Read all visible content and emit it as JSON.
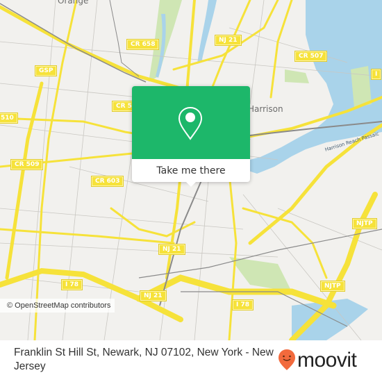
{
  "map": {
    "place_labels": {
      "orange": "Orange",
      "harrison": "Harrison"
    },
    "water_label": "Harrison Reach Passaic",
    "road_shields": [
      {
        "id": "cr658",
        "label": "CR 658"
      },
      {
        "id": "nj21-top",
        "label": "NJ 21"
      },
      {
        "id": "cr507",
        "label": "CR 507"
      },
      {
        "id": "gsp",
        "label": "GSP"
      },
      {
        "id": "cr5xx",
        "label": "CR 5"
      },
      {
        "id": "cr510",
        "label": "510"
      },
      {
        "id": "cr509",
        "label": "CR 509"
      },
      {
        "id": "cr603",
        "label": "CR 603"
      },
      {
        "id": "nj21-mid",
        "label": "NJ 21"
      },
      {
        "id": "i78-left",
        "label": "I 78"
      },
      {
        "id": "nj21-low",
        "label": "NJ 21"
      },
      {
        "id": "i78-right",
        "label": "I 78"
      },
      {
        "id": "njtp-upper",
        "label": "NJTP"
      },
      {
        "id": "njtp-lower",
        "label": "NJTP"
      },
      {
        "id": "i-edge",
        "label": "I"
      }
    ],
    "attribution": "© OpenStreetMap contributors",
    "colors": {
      "land": "#f2f1ee",
      "road": "#f6e23a",
      "water": "#a9d3ea",
      "park": "#cfe6b4"
    }
  },
  "popup": {
    "icon": "map-pin-icon",
    "button_label": "Take me there",
    "color": "#1db76a"
  },
  "footer": {
    "address": "Franklin St Hill St, Newark, NJ 07102, New York - New Jersey",
    "logo_text": "moovit",
    "logo_color": "#f26a3d"
  }
}
